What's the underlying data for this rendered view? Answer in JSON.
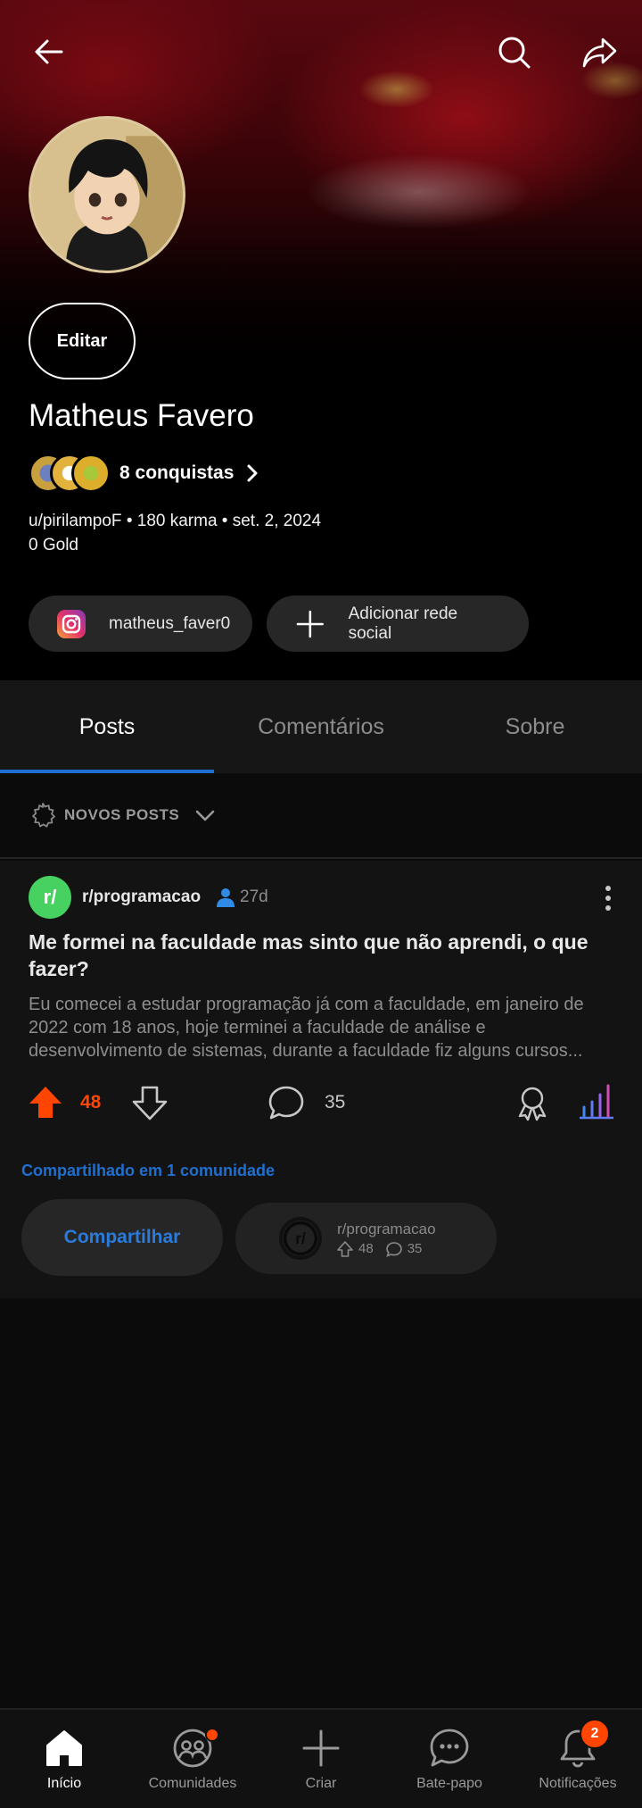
{
  "profile": {
    "display_name": "Matheus Favero",
    "edit_label": "Editar",
    "achievements_label": "8 conquistas",
    "meta_line": "u/pirilampoF • 180 karma • set. 2, 2024",
    "gold_line": "0 Gold",
    "social_instagram": "matheus_faver0",
    "add_social_label": "Adicionar rede social"
  },
  "tabs": [
    {
      "label": "Posts",
      "active": true
    },
    {
      "label": "Comentários",
      "active": false
    },
    {
      "label": "Sobre",
      "active": false
    }
  ],
  "sort": {
    "label": "NOVOS POSTS"
  },
  "post": {
    "subreddit": "r/programacao",
    "subreddit_logo": "r/",
    "age": "27d",
    "title": "Me formei na faculdade mas sinto que não aprendi, o que fazer?",
    "body": "Eu comecei a estudar programação já com a faculdade, em janeiro de 2022 com 18 anos, hoje terminei a faculdade de análise e desenvolvimento de sistemas, durante a faculdade fiz alguns cursos...",
    "votes": "48",
    "comments": "35",
    "shared_note": "Compartilhado em 1 comunidade",
    "share_label": "Compartilhar",
    "crosspost": {
      "subreddit": "r/programacao",
      "logo": "r/",
      "votes": "48",
      "comments": "35"
    }
  },
  "nav": {
    "items": [
      {
        "label": "Início",
        "active": true
      },
      {
        "label": "Comunidades",
        "active": false
      },
      {
        "label": "Criar",
        "active": false
      },
      {
        "label": "Bate-papo",
        "active": false
      },
      {
        "label": "Notificações",
        "active": false
      }
    ],
    "notifications_badge": "2"
  },
  "colors": {
    "accent_upvote": "#ff4500",
    "link_blue": "#1f6fd0",
    "subreddit_green": "#46d160",
    "background": "#0b0b0b"
  },
  "icons": [
    "back-arrow-icon",
    "search-icon",
    "share-arrow-icon",
    "chevron-right-icon",
    "instagram-icon",
    "plus-icon",
    "gear-icon",
    "chevron-down-icon",
    "op-user-icon",
    "more-vertical-icon",
    "upvote-icon",
    "downvote-icon",
    "comment-icon",
    "award-icon",
    "insights-icon",
    "home-icon",
    "communities-icon",
    "create-icon",
    "chat-icon",
    "bell-icon"
  ]
}
